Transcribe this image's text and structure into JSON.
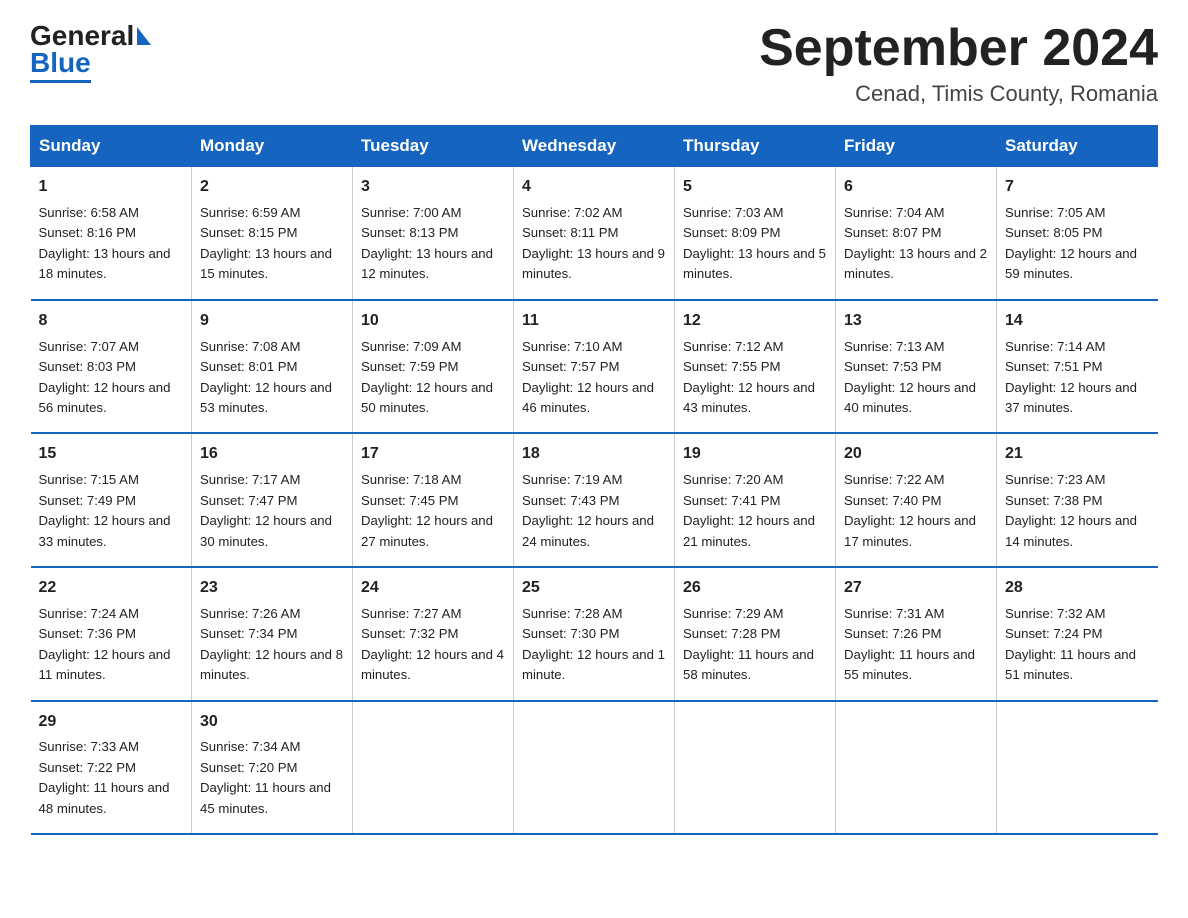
{
  "header": {
    "logo_general": "General",
    "logo_blue": "Blue",
    "month_title": "September 2024",
    "location": "Cenad, Timis County, Romania"
  },
  "days_of_week": [
    "Sunday",
    "Monday",
    "Tuesday",
    "Wednesday",
    "Thursday",
    "Friday",
    "Saturday"
  ],
  "weeks": [
    [
      {
        "day": "1",
        "sunrise": "6:58 AM",
        "sunset": "8:16 PM",
        "daylight": "13 hours and 18 minutes."
      },
      {
        "day": "2",
        "sunrise": "6:59 AM",
        "sunset": "8:15 PM",
        "daylight": "13 hours and 15 minutes."
      },
      {
        "day": "3",
        "sunrise": "7:00 AM",
        "sunset": "8:13 PM",
        "daylight": "13 hours and 12 minutes."
      },
      {
        "day": "4",
        "sunrise": "7:02 AM",
        "sunset": "8:11 PM",
        "daylight": "13 hours and 9 minutes."
      },
      {
        "day": "5",
        "sunrise": "7:03 AM",
        "sunset": "8:09 PM",
        "daylight": "13 hours and 5 minutes."
      },
      {
        "day": "6",
        "sunrise": "7:04 AM",
        "sunset": "8:07 PM",
        "daylight": "13 hours and 2 minutes."
      },
      {
        "day": "7",
        "sunrise": "7:05 AM",
        "sunset": "8:05 PM",
        "daylight": "12 hours and 59 minutes."
      }
    ],
    [
      {
        "day": "8",
        "sunrise": "7:07 AM",
        "sunset": "8:03 PM",
        "daylight": "12 hours and 56 minutes."
      },
      {
        "day": "9",
        "sunrise": "7:08 AM",
        "sunset": "8:01 PM",
        "daylight": "12 hours and 53 minutes."
      },
      {
        "day": "10",
        "sunrise": "7:09 AM",
        "sunset": "7:59 PM",
        "daylight": "12 hours and 50 minutes."
      },
      {
        "day": "11",
        "sunrise": "7:10 AM",
        "sunset": "7:57 PM",
        "daylight": "12 hours and 46 minutes."
      },
      {
        "day": "12",
        "sunrise": "7:12 AM",
        "sunset": "7:55 PM",
        "daylight": "12 hours and 43 minutes."
      },
      {
        "day": "13",
        "sunrise": "7:13 AM",
        "sunset": "7:53 PM",
        "daylight": "12 hours and 40 minutes."
      },
      {
        "day": "14",
        "sunrise": "7:14 AM",
        "sunset": "7:51 PM",
        "daylight": "12 hours and 37 minutes."
      }
    ],
    [
      {
        "day": "15",
        "sunrise": "7:15 AM",
        "sunset": "7:49 PM",
        "daylight": "12 hours and 33 minutes."
      },
      {
        "day": "16",
        "sunrise": "7:17 AM",
        "sunset": "7:47 PM",
        "daylight": "12 hours and 30 minutes."
      },
      {
        "day": "17",
        "sunrise": "7:18 AM",
        "sunset": "7:45 PM",
        "daylight": "12 hours and 27 minutes."
      },
      {
        "day": "18",
        "sunrise": "7:19 AM",
        "sunset": "7:43 PM",
        "daylight": "12 hours and 24 minutes."
      },
      {
        "day": "19",
        "sunrise": "7:20 AM",
        "sunset": "7:41 PM",
        "daylight": "12 hours and 21 minutes."
      },
      {
        "day": "20",
        "sunrise": "7:22 AM",
        "sunset": "7:40 PM",
        "daylight": "12 hours and 17 minutes."
      },
      {
        "day": "21",
        "sunrise": "7:23 AM",
        "sunset": "7:38 PM",
        "daylight": "12 hours and 14 minutes."
      }
    ],
    [
      {
        "day": "22",
        "sunrise": "7:24 AM",
        "sunset": "7:36 PM",
        "daylight": "12 hours and 11 minutes."
      },
      {
        "day": "23",
        "sunrise": "7:26 AM",
        "sunset": "7:34 PM",
        "daylight": "12 hours and 8 minutes."
      },
      {
        "day": "24",
        "sunrise": "7:27 AM",
        "sunset": "7:32 PM",
        "daylight": "12 hours and 4 minutes."
      },
      {
        "day": "25",
        "sunrise": "7:28 AM",
        "sunset": "7:30 PM",
        "daylight": "12 hours and 1 minute."
      },
      {
        "day": "26",
        "sunrise": "7:29 AM",
        "sunset": "7:28 PM",
        "daylight": "11 hours and 58 minutes."
      },
      {
        "day": "27",
        "sunrise": "7:31 AM",
        "sunset": "7:26 PM",
        "daylight": "11 hours and 55 minutes."
      },
      {
        "day": "28",
        "sunrise": "7:32 AM",
        "sunset": "7:24 PM",
        "daylight": "11 hours and 51 minutes."
      }
    ],
    [
      {
        "day": "29",
        "sunrise": "7:33 AM",
        "sunset": "7:22 PM",
        "daylight": "11 hours and 48 minutes."
      },
      {
        "day": "30",
        "sunrise": "7:34 AM",
        "sunset": "7:20 PM",
        "daylight": "11 hours and 45 minutes."
      },
      null,
      null,
      null,
      null,
      null
    ]
  ],
  "labels": {
    "sunrise": "Sunrise:",
    "sunset": "Sunset:",
    "daylight": "Daylight:"
  }
}
